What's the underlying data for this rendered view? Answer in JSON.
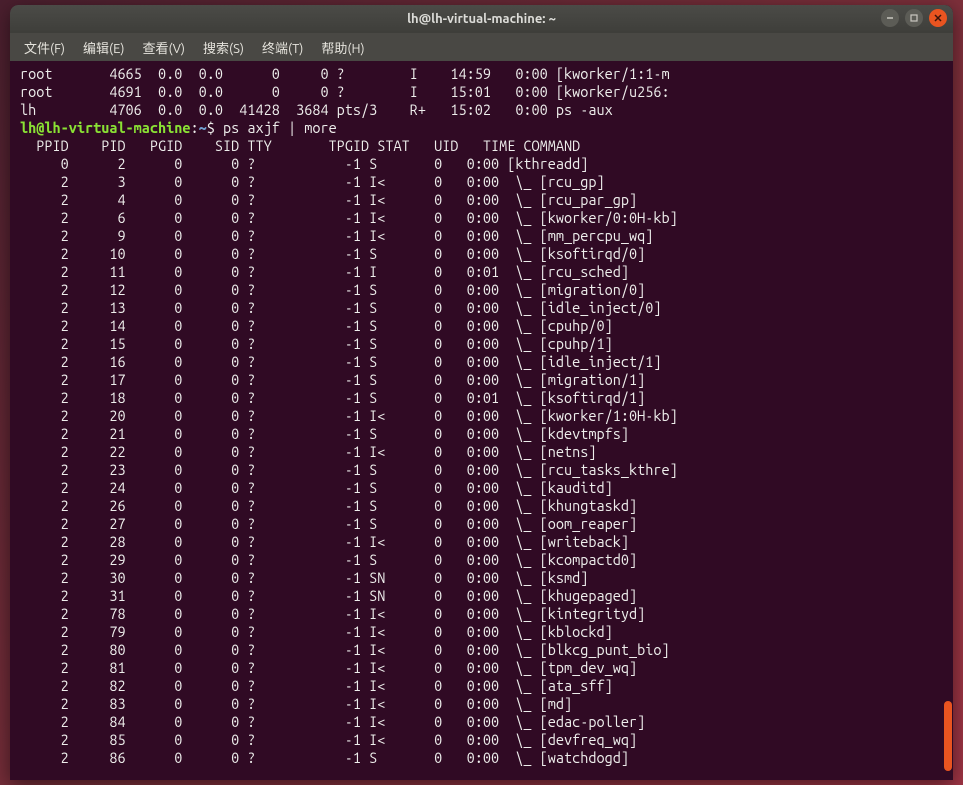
{
  "window": {
    "title": "lh@lh-virtual-machine: ~"
  },
  "menu": {
    "file": "文件(F)",
    "edit": "编辑(E)",
    "view": "查看(V)",
    "search": "搜索(S)",
    "terminal": "终端(T)",
    "help": "帮助(H)"
  },
  "prompt": {
    "userhost": "lh@lh-virtual-machine",
    "sep": ":",
    "path": "~",
    "dollar": "$",
    "command": " ps axjf | more"
  },
  "pre_lines": [
    "root       4665  0.0  0.0      0     0 ?        I    14:59   0:00 [kworker/1:1-m",
    "root       4691  0.0  0.0      0     0 ?        I    15:01   0:00 [kworker/u256:",
    "lh         4706  0.0  0.0  41428  3684 pts/3    R+   15:02   0:00 ps -aux"
  ],
  "header": "  PPID    PID   PGID    SID TTY       TPGID STAT   UID   TIME COMMAND",
  "rows": [
    {
      "ppid": 0,
      "pid": 2,
      "pgid": 0,
      "sid": 0,
      "tty": "?",
      "tpgid": -1,
      "stat": "S",
      "uid": 0,
      "time": "0:00",
      "cmd": "[kthreadd]",
      "child": false
    },
    {
      "ppid": 2,
      "pid": 3,
      "pgid": 0,
      "sid": 0,
      "tty": "?",
      "tpgid": -1,
      "stat": "I<",
      "uid": 0,
      "time": "0:00",
      "cmd": "[rcu_gp]",
      "child": true
    },
    {
      "ppid": 2,
      "pid": 4,
      "pgid": 0,
      "sid": 0,
      "tty": "?",
      "tpgid": -1,
      "stat": "I<",
      "uid": 0,
      "time": "0:00",
      "cmd": "[rcu_par_gp]",
      "child": true
    },
    {
      "ppid": 2,
      "pid": 6,
      "pgid": 0,
      "sid": 0,
      "tty": "?",
      "tpgid": -1,
      "stat": "I<",
      "uid": 0,
      "time": "0:00",
      "cmd": "[kworker/0:0H-kb]",
      "child": true
    },
    {
      "ppid": 2,
      "pid": 9,
      "pgid": 0,
      "sid": 0,
      "tty": "?",
      "tpgid": -1,
      "stat": "I<",
      "uid": 0,
      "time": "0:00",
      "cmd": "[mm_percpu_wq]",
      "child": true
    },
    {
      "ppid": 2,
      "pid": 10,
      "pgid": 0,
      "sid": 0,
      "tty": "?",
      "tpgid": -1,
      "stat": "S",
      "uid": 0,
      "time": "0:00",
      "cmd": "[ksoftirqd/0]",
      "child": true
    },
    {
      "ppid": 2,
      "pid": 11,
      "pgid": 0,
      "sid": 0,
      "tty": "?",
      "tpgid": -1,
      "stat": "I",
      "uid": 0,
      "time": "0:01",
      "cmd": "[rcu_sched]",
      "child": true
    },
    {
      "ppid": 2,
      "pid": 12,
      "pgid": 0,
      "sid": 0,
      "tty": "?",
      "tpgid": -1,
      "stat": "S",
      "uid": 0,
      "time": "0:00",
      "cmd": "[migration/0]",
      "child": true
    },
    {
      "ppid": 2,
      "pid": 13,
      "pgid": 0,
      "sid": 0,
      "tty": "?",
      "tpgid": -1,
      "stat": "S",
      "uid": 0,
      "time": "0:00",
      "cmd": "[idle_inject/0]",
      "child": true
    },
    {
      "ppid": 2,
      "pid": 14,
      "pgid": 0,
      "sid": 0,
      "tty": "?",
      "tpgid": -1,
      "stat": "S",
      "uid": 0,
      "time": "0:00",
      "cmd": "[cpuhp/0]",
      "child": true
    },
    {
      "ppid": 2,
      "pid": 15,
      "pgid": 0,
      "sid": 0,
      "tty": "?",
      "tpgid": -1,
      "stat": "S",
      "uid": 0,
      "time": "0:00",
      "cmd": "[cpuhp/1]",
      "child": true
    },
    {
      "ppid": 2,
      "pid": 16,
      "pgid": 0,
      "sid": 0,
      "tty": "?",
      "tpgid": -1,
      "stat": "S",
      "uid": 0,
      "time": "0:00",
      "cmd": "[idle_inject/1]",
      "child": true
    },
    {
      "ppid": 2,
      "pid": 17,
      "pgid": 0,
      "sid": 0,
      "tty": "?",
      "tpgid": -1,
      "stat": "S",
      "uid": 0,
      "time": "0:00",
      "cmd": "[migration/1]",
      "child": true
    },
    {
      "ppid": 2,
      "pid": 18,
      "pgid": 0,
      "sid": 0,
      "tty": "?",
      "tpgid": -1,
      "stat": "S",
      "uid": 0,
      "time": "0:01",
      "cmd": "[ksoftirqd/1]",
      "child": true
    },
    {
      "ppid": 2,
      "pid": 20,
      "pgid": 0,
      "sid": 0,
      "tty": "?",
      "tpgid": -1,
      "stat": "I<",
      "uid": 0,
      "time": "0:00",
      "cmd": "[kworker/1:0H-kb]",
      "child": true
    },
    {
      "ppid": 2,
      "pid": 21,
      "pgid": 0,
      "sid": 0,
      "tty": "?",
      "tpgid": -1,
      "stat": "S",
      "uid": 0,
      "time": "0:00",
      "cmd": "[kdevtmpfs]",
      "child": true
    },
    {
      "ppid": 2,
      "pid": 22,
      "pgid": 0,
      "sid": 0,
      "tty": "?",
      "tpgid": -1,
      "stat": "I<",
      "uid": 0,
      "time": "0:00",
      "cmd": "[netns]",
      "child": true
    },
    {
      "ppid": 2,
      "pid": 23,
      "pgid": 0,
      "sid": 0,
      "tty": "?",
      "tpgid": -1,
      "stat": "S",
      "uid": 0,
      "time": "0:00",
      "cmd": "[rcu_tasks_kthre]",
      "child": true
    },
    {
      "ppid": 2,
      "pid": 24,
      "pgid": 0,
      "sid": 0,
      "tty": "?",
      "tpgid": -1,
      "stat": "S",
      "uid": 0,
      "time": "0:00",
      "cmd": "[kauditd]",
      "child": true
    },
    {
      "ppid": 2,
      "pid": 26,
      "pgid": 0,
      "sid": 0,
      "tty": "?",
      "tpgid": -1,
      "stat": "S",
      "uid": 0,
      "time": "0:00",
      "cmd": "[khungtaskd]",
      "child": true
    },
    {
      "ppid": 2,
      "pid": 27,
      "pgid": 0,
      "sid": 0,
      "tty": "?",
      "tpgid": -1,
      "stat": "S",
      "uid": 0,
      "time": "0:00",
      "cmd": "[oom_reaper]",
      "child": true
    },
    {
      "ppid": 2,
      "pid": 28,
      "pgid": 0,
      "sid": 0,
      "tty": "?",
      "tpgid": -1,
      "stat": "I<",
      "uid": 0,
      "time": "0:00",
      "cmd": "[writeback]",
      "child": true
    },
    {
      "ppid": 2,
      "pid": 29,
      "pgid": 0,
      "sid": 0,
      "tty": "?",
      "tpgid": -1,
      "stat": "S",
      "uid": 0,
      "time": "0:00",
      "cmd": "[kcompactd0]",
      "child": true
    },
    {
      "ppid": 2,
      "pid": 30,
      "pgid": 0,
      "sid": 0,
      "tty": "?",
      "tpgid": -1,
      "stat": "SN",
      "uid": 0,
      "time": "0:00",
      "cmd": "[ksmd]",
      "child": true
    },
    {
      "ppid": 2,
      "pid": 31,
      "pgid": 0,
      "sid": 0,
      "tty": "?",
      "tpgid": -1,
      "stat": "SN",
      "uid": 0,
      "time": "0:00",
      "cmd": "[khugepaged]",
      "child": true
    },
    {
      "ppid": 2,
      "pid": 78,
      "pgid": 0,
      "sid": 0,
      "tty": "?",
      "tpgid": -1,
      "stat": "I<",
      "uid": 0,
      "time": "0:00",
      "cmd": "[kintegrityd]",
      "child": true
    },
    {
      "ppid": 2,
      "pid": 79,
      "pgid": 0,
      "sid": 0,
      "tty": "?",
      "tpgid": -1,
      "stat": "I<",
      "uid": 0,
      "time": "0:00",
      "cmd": "[kblockd]",
      "child": true
    },
    {
      "ppid": 2,
      "pid": 80,
      "pgid": 0,
      "sid": 0,
      "tty": "?",
      "tpgid": -1,
      "stat": "I<",
      "uid": 0,
      "time": "0:00",
      "cmd": "[blkcg_punt_bio]",
      "child": true
    },
    {
      "ppid": 2,
      "pid": 81,
      "pgid": 0,
      "sid": 0,
      "tty": "?",
      "tpgid": -1,
      "stat": "I<",
      "uid": 0,
      "time": "0:00",
      "cmd": "[tpm_dev_wq]",
      "child": true
    },
    {
      "ppid": 2,
      "pid": 82,
      "pgid": 0,
      "sid": 0,
      "tty": "?",
      "tpgid": -1,
      "stat": "I<",
      "uid": 0,
      "time": "0:00",
      "cmd": "[ata_sff]",
      "child": true
    },
    {
      "ppid": 2,
      "pid": 83,
      "pgid": 0,
      "sid": 0,
      "tty": "?",
      "tpgid": -1,
      "stat": "I<",
      "uid": 0,
      "time": "0:00",
      "cmd": "[md]",
      "child": true
    },
    {
      "ppid": 2,
      "pid": 84,
      "pgid": 0,
      "sid": 0,
      "tty": "?",
      "tpgid": -1,
      "stat": "I<",
      "uid": 0,
      "time": "0:00",
      "cmd": "[edac-poller]",
      "child": true
    },
    {
      "ppid": 2,
      "pid": 85,
      "pgid": 0,
      "sid": 0,
      "tty": "?",
      "tpgid": -1,
      "stat": "I<",
      "uid": 0,
      "time": "0:00",
      "cmd": "[devfreq_wq]",
      "child": true
    },
    {
      "ppid": 2,
      "pid": 86,
      "pgid": 0,
      "sid": 0,
      "tty": "?",
      "tpgid": -1,
      "stat": "S",
      "uid": 0,
      "time": "0:00",
      "cmd": "[watchdogd]",
      "child": true
    }
  ]
}
